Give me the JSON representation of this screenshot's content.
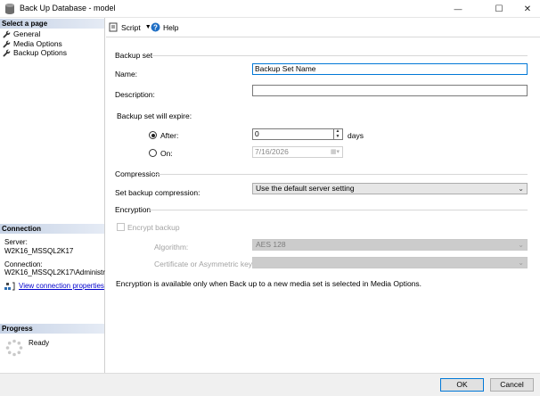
{
  "window": {
    "title": "Back Up Database - model",
    "minimize_glyph": "—",
    "maximize_glyph": "☐",
    "close_glyph": "✕"
  },
  "left": {
    "select_page_header": "Select a page",
    "pages": [
      {
        "label": "General",
        "icon": "wrench-icon"
      },
      {
        "label": "Media Options",
        "icon": "wrench-icon"
      },
      {
        "label": "Backup Options",
        "icon": "wrench-icon"
      }
    ],
    "connection_header": "Connection",
    "server_label": "Server:",
    "server_value": "W2K16_MSSQL2K17",
    "connection_label": "Connection:",
    "connection_value": "W2K16_MSSQL2K17\\Administrato",
    "view_properties_link": "View connection properties",
    "progress_header": "Progress",
    "progress_status": "Ready"
  },
  "toolbar": {
    "script_label": "Script",
    "help_label": "Help"
  },
  "backup_set": {
    "group_label": "Backup set",
    "name_label": "Name:",
    "name_value": "Backup Set Name",
    "description_label": "Description:",
    "description_value": "",
    "expire_label": "Backup set will expire:",
    "after_label": "After:",
    "after_value": "0",
    "days_label": "days",
    "on_label": "On:",
    "on_value": "7/16/2026"
  },
  "compression": {
    "group_label": "Compression",
    "set_label": "Set backup compression:",
    "value": "Use the default server setting"
  },
  "encryption": {
    "group_label": "Encryption",
    "encrypt_label": "Encrypt backup",
    "algorithm_label": "Algorithm:",
    "algorithm_value": "AES 128",
    "cert_label": "Certificate or Asymmetric key:",
    "cert_value": "",
    "note": "Encryption is available only when Back up to a new media set is selected in Media Options."
  },
  "footer": {
    "ok_label": "OK",
    "cancel_label": "Cancel"
  },
  "colors": {
    "accent": "#0078d7",
    "header_gradient_start": "#c7d3e6",
    "link": "#0000cc"
  }
}
